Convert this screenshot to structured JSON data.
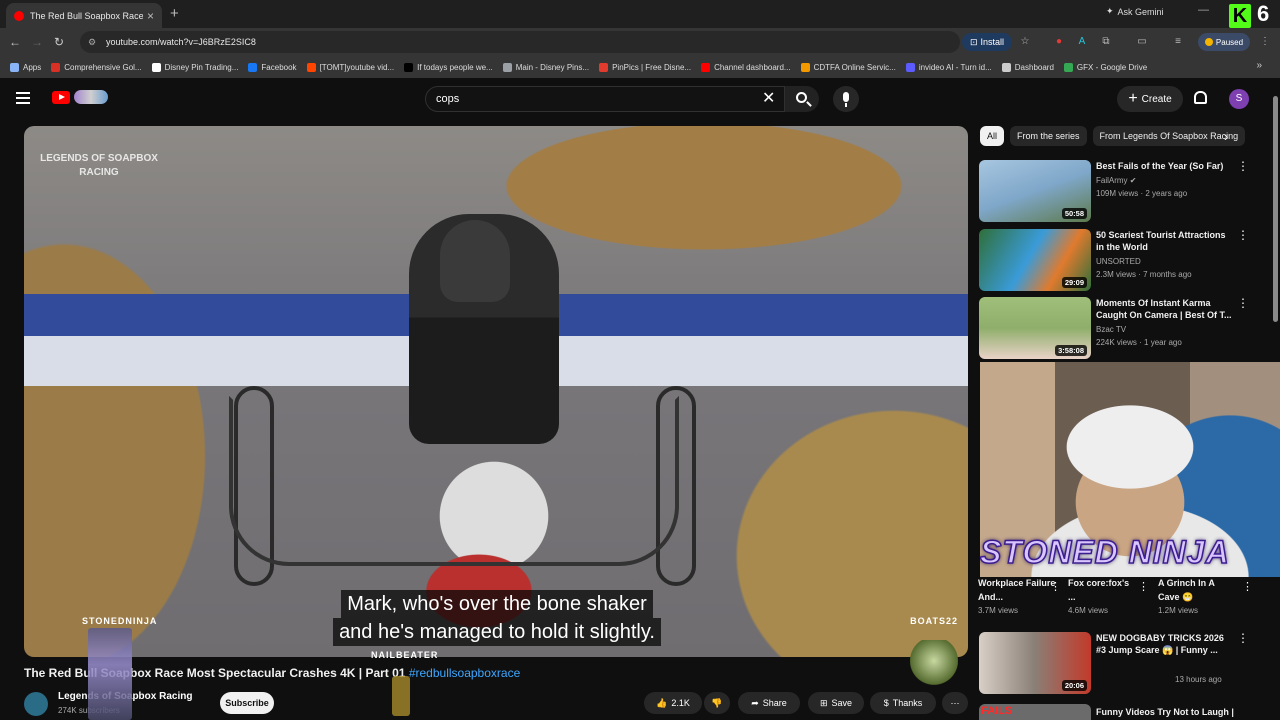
{
  "browser": {
    "tab_title": "The Red Bull Soapbox Race",
    "ask_gemini": "Ask Gemini",
    "kick_count": "6",
    "kick_letter": "K",
    "url": "youtube.com/watch?v=J6BRzE2SIC8",
    "install_label": "Install",
    "paused_label": "Paused",
    "bookmarks": [
      {
        "label": "Apps",
        "color": "#8ab4f8"
      },
      {
        "label": "Comprehensive Gol...",
        "color": "#d93025"
      },
      {
        "label": "Disney Pin Trading...",
        "color": "#ffffff"
      },
      {
        "label": "Facebook",
        "color": "#1877f2"
      },
      {
        "label": "[TOMT]youtube vid...",
        "color": "#ff4500"
      },
      {
        "label": "If todays people we...",
        "color": "#000000"
      },
      {
        "label": "Main - Disney Pins...",
        "color": "#9aa0a6"
      },
      {
        "label": "PinPics | Free Disne...",
        "color": "#e23b2e"
      },
      {
        "label": "Channel dashboard...",
        "color": "#ff0000"
      },
      {
        "label": "CDTFA Online Servic...",
        "color": "#f29900"
      },
      {
        "label": "invideo AI - Turn id...",
        "color": "#5b5bff"
      },
      {
        "label": "Dashboard",
        "color": "#cccccc"
      },
      {
        "label": "GFX - Google Drive",
        "color": "#34a853"
      }
    ]
  },
  "youtube": {
    "search_value": "cops",
    "create_label": "Create",
    "avatar_letter": "S"
  },
  "video": {
    "watermark": "LEGENDS OF SOAPBOX RACING",
    "caption_line1": "Mark, who's over the bone shaker",
    "caption_line2": "and he's managed to hold it slightly.",
    "hud_left": "STONEDNINJA",
    "hud_right": "BOATS22",
    "hud_mid": "NAILBEATER",
    "title": "The Red Bull Soapbox Race Most Spectacular Crashes 4K | Part 01",
    "hashtag": "#redbullsoapboxrace",
    "channel": "Legends of Soapbox Racing",
    "subs": "274K subscribers",
    "subscribe_label": "Subscribe",
    "likes": "2.1K",
    "share_label": "Share",
    "save_label": "Save",
    "thanks_label": "Thanks"
  },
  "chips": [
    "All",
    "From the series",
    "From Legends Of Soapbox Racing"
  ],
  "recommendations": [
    {
      "title": "Best Fails of the Year (So Far)",
      "channel": "FailArmy",
      "meta": "109M views · 2 years ago",
      "duration": "50:58",
      "thumb_color": "#7fa7c9"
    },
    {
      "title": "50 Scariest Tourist Attractions in the World",
      "channel": "UNSORTED",
      "meta": "2.3M views · 7 months ago",
      "duration": "29:09",
      "thumb_color": "#3a9bd8"
    },
    {
      "title": "Moments Of Instant Karma Caught On Camera | Best Of T...",
      "channel": "Bzac TV",
      "meta": "224K views · 1 year ago",
      "duration": "3:58:08",
      "thumb_color": "#8fae6b"
    }
  ],
  "webcam_text": "STONED NINJA",
  "shorts": [
    {
      "title": "Workplace Failure And...",
      "views": "3.7M views"
    },
    {
      "title": "Fox core:fox's ...",
      "views": "4.6M views"
    },
    {
      "title": "A Grinch In A Cave 😁",
      "views": "1.2M views"
    }
  ],
  "bottom_recs": [
    {
      "title": "NEW DOGBABY TRICKS 2026 #3 Jump Scare 😱 | Funny ...",
      "meta": "13 hours ago",
      "duration": "20:06"
    },
    {
      "title": "Funny Videos Try Not to Laugh |",
      "badge": "FAILS"
    }
  ]
}
